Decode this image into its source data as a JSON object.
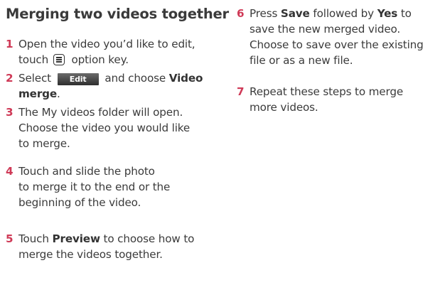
{
  "title": "Merging two videos together",
  "steps": [
    {
      "num": "1",
      "line1_a": "Open the video you’d like to edit,",
      "line2_a": "touch",
      "line2_b": "option key."
    },
    {
      "num": "2",
      "line1_a": "Select",
      "button": "Edit",
      "line1_b": "and choose",
      "line1_bold": "Video",
      "line2_bold": "merge",
      "line2_end": "."
    },
    {
      "num": "3",
      "lines": [
        "The My videos folder will open.",
        "Choose the video you would like",
        "to merge."
      ]
    },
    {
      "num": "4",
      "lines": [
        "Touch and slide the photo",
        "to merge it to the end or the",
        "beginning of the video."
      ]
    },
    {
      "num": "5",
      "line1_a": "Touch",
      "line1_bold": "Preview",
      "line1_b": "to choose how to",
      "line2": "merge the videos together."
    },
    {
      "num": "6",
      "line1_a": "Press",
      "line1_bold1": "Save",
      "line1_b": "followed by",
      "line1_bold2": "Yes",
      "line1_c": "to",
      "line2": "save the new merged video.",
      "line3": "Choose to save over the existing",
      "line4": "file or as a new file."
    },
    {
      "num": "7",
      "lines": [
        "Repeat these steps to merge",
        "more videos."
      ]
    }
  ],
  "icons": {
    "option_key": "option-menu-key-icon"
  },
  "colors": {
    "step_number": "#cf3a57",
    "text": "#3b3b3b",
    "button_bg": "#3a3a3a"
  }
}
